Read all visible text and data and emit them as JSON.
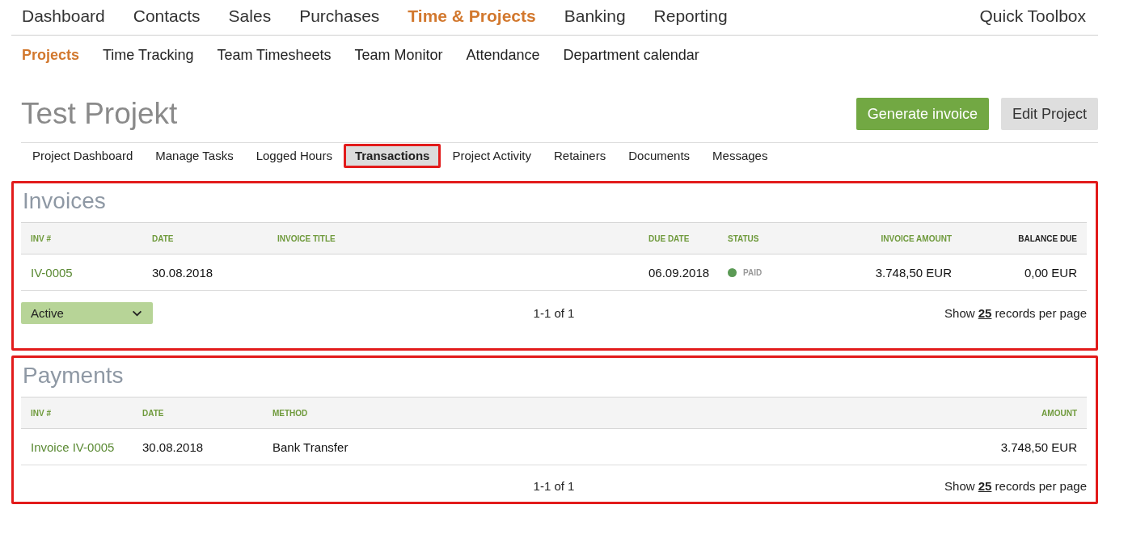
{
  "main_nav": {
    "items": [
      {
        "label": "Dashboard",
        "selected": false
      },
      {
        "label": "Contacts",
        "selected": false
      },
      {
        "label": "Sales",
        "selected": false
      },
      {
        "label": "Purchases",
        "selected": false
      },
      {
        "label": "Time & Projects",
        "selected": true
      },
      {
        "label": "Banking",
        "selected": false
      },
      {
        "label": "Reporting",
        "selected": false
      }
    ],
    "toolbox": "Quick Toolbox"
  },
  "sub_nav": {
    "items": [
      {
        "label": "Projects",
        "selected": true
      },
      {
        "label": "Time Tracking",
        "selected": false
      },
      {
        "label": "Team Timesheets",
        "selected": false
      },
      {
        "label": "Team Monitor",
        "selected": false
      },
      {
        "label": "Attendance",
        "selected": false
      },
      {
        "label": "Department calendar",
        "selected": false
      }
    ]
  },
  "project": {
    "title": "Test Projekt",
    "buttons": [
      {
        "label": "Generate invoice",
        "kind": "primary"
      },
      {
        "label": "Edit Project",
        "kind": "secondary"
      }
    ]
  },
  "tabs": [
    {
      "label": "Project Dashboard",
      "selected": false,
      "highlighted": false
    },
    {
      "label": "Manage Tasks",
      "selected": false,
      "highlighted": false
    },
    {
      "label": "Logged Hours",
      "selected": false,
      "highlighted": false
    },
    {
      "label": "Transactions",
      "selected": true,
      "highlighted": true
    },
    {
      "label": "Project Activity",
      "selected": false,
      "highlighted": false
    },
    {
      "label": "Retainers",
      "selected": false,
      "highlighted": false
    },
    {
      "label": "Documents",
      "selected": false,
      "highlighted": false
    },
    {
      "label": "Messages",
      "selected": false,
      "highlighted": false
    }
  ],
  "invoices": {
    "title": "Invoices",
    "highlighted": true,
    "columns": [
      {
        "label": "INV #",
        "sortable": true
      },
      {
        "label": "DATE",
        "sortable": true
      },
      {
        "label": "INVOICE TITLE",
        "sortable": true
      },
      {
        "label": "DUE DATE",
        "sortable": true
      },
      {
        "label": "STATUS",
        "sortable": true
      },
      {
        "label": "INVOICE AMOUNT",
        "sortable": true
      },
      {
        "label": "BALANCE DUE",
        "sortable": false
      }
    ],
    "rows": [
      {
        "inv": "IV-0005",
        "date": "30.08.2018",
        "due_date": "06.09.2018",
        "status": "PAID",
        "color": "#5b9a55",
        "amount": "3.748,50 EUR",
        "balance": "0,00 EUR"
      }
    ],
    "filter": "Active",
    "pagination": "1-1 of 1",
    "per_page": {
      "before": "Show",
      "count": "25",
      "after": "records per page"
    }
  },
  "payments": {
    "title": "Payments",
    "highlighted": true,
    "columns": [
      {
        "label": "INV #",
        "sortable": true
      },
      {
        "label": "DATE",
        "sortable": true
      },
      {
        "label": "METHOD",
        "sortable": true
      },
      {
        "label": "AMOUNT",
        "sortable": true
      }
    ],
    "rows": [
      {
        "inv": "Invoice IV-0005",
        "date": "30.08.2018",
        "method": "Bank Transfer",
        "amount": "3.748,50 EUR"
      }
    ],
    "pagination": "1-1 of 1",
    "per_page": {
      "before": "Show",
      "count": "25",
      "after": "records per page"
    }
  }
}
